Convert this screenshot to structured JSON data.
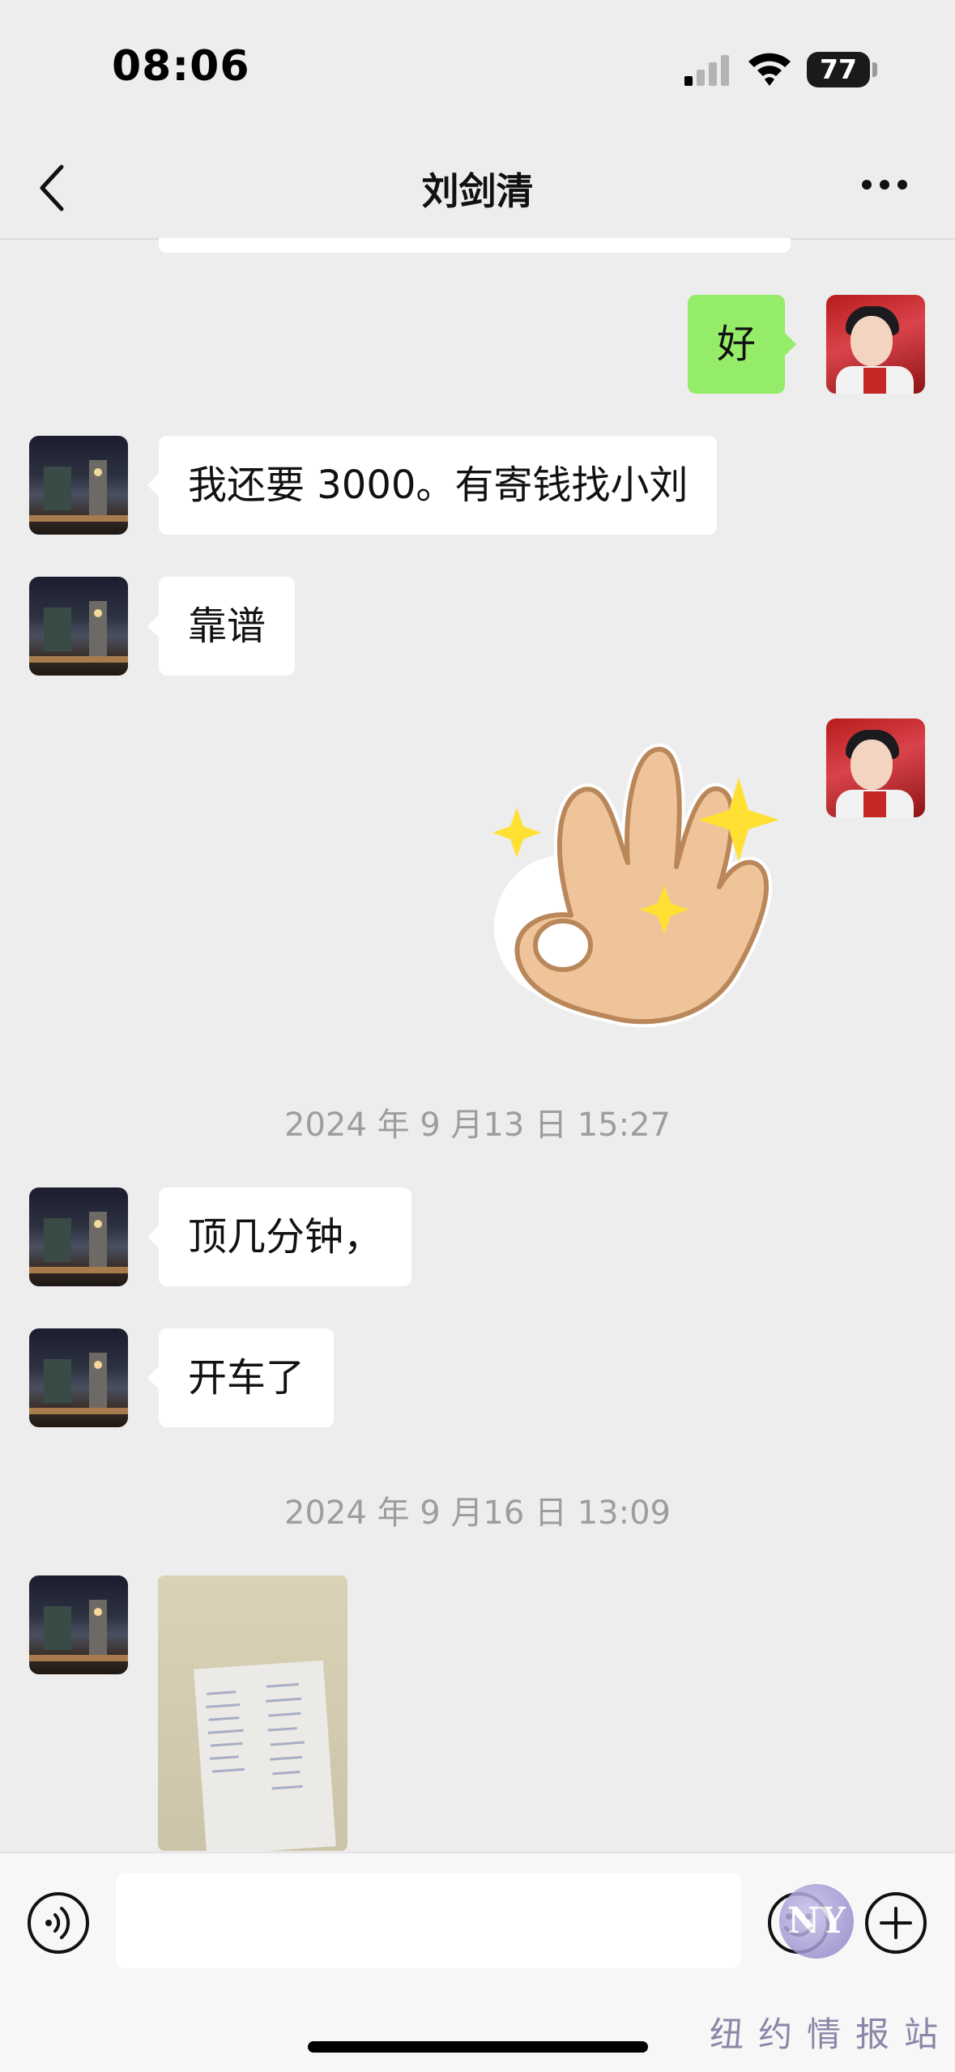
{
  "status_bar": {
    "time": "08:06",
    "battery": "77"
  },
  "nav": {
    "title": "刘剑清"
  },
  "messages": [
    {
      "side": "out",
      "text": "好"
    },
    {
      "side": "in",
      "text": "我还要 3000。有寄钱找小刘"
    },
    {
      "side": "in",
      "text": "靠谱"
    },
    {
      "side": "out",
      "type": "sticker",
      "sticker": "ok-hand-sparkle"
    },
    {
      "type": "timestamp",
      "text": "2024 年 9 月13 日 15:27"
    },
    {
      "side": "in",
      "text": "顶几分钟，"
    },
    {
      "side": "in",
      "text": "开车了"
    },
    {
      "type": "timestamp",
      "text": "2024 年 9 月16 日 13:09"
    },
    {
      "side": "in",
      "type": "image",
      "image": "handwritten-note-photo"
    }
  ],
  "input_bar": {
    "placeholder": ""
  },
  "watermark": {
    "logo": "NY",
    "text": "纽约情报站"
  }
}
